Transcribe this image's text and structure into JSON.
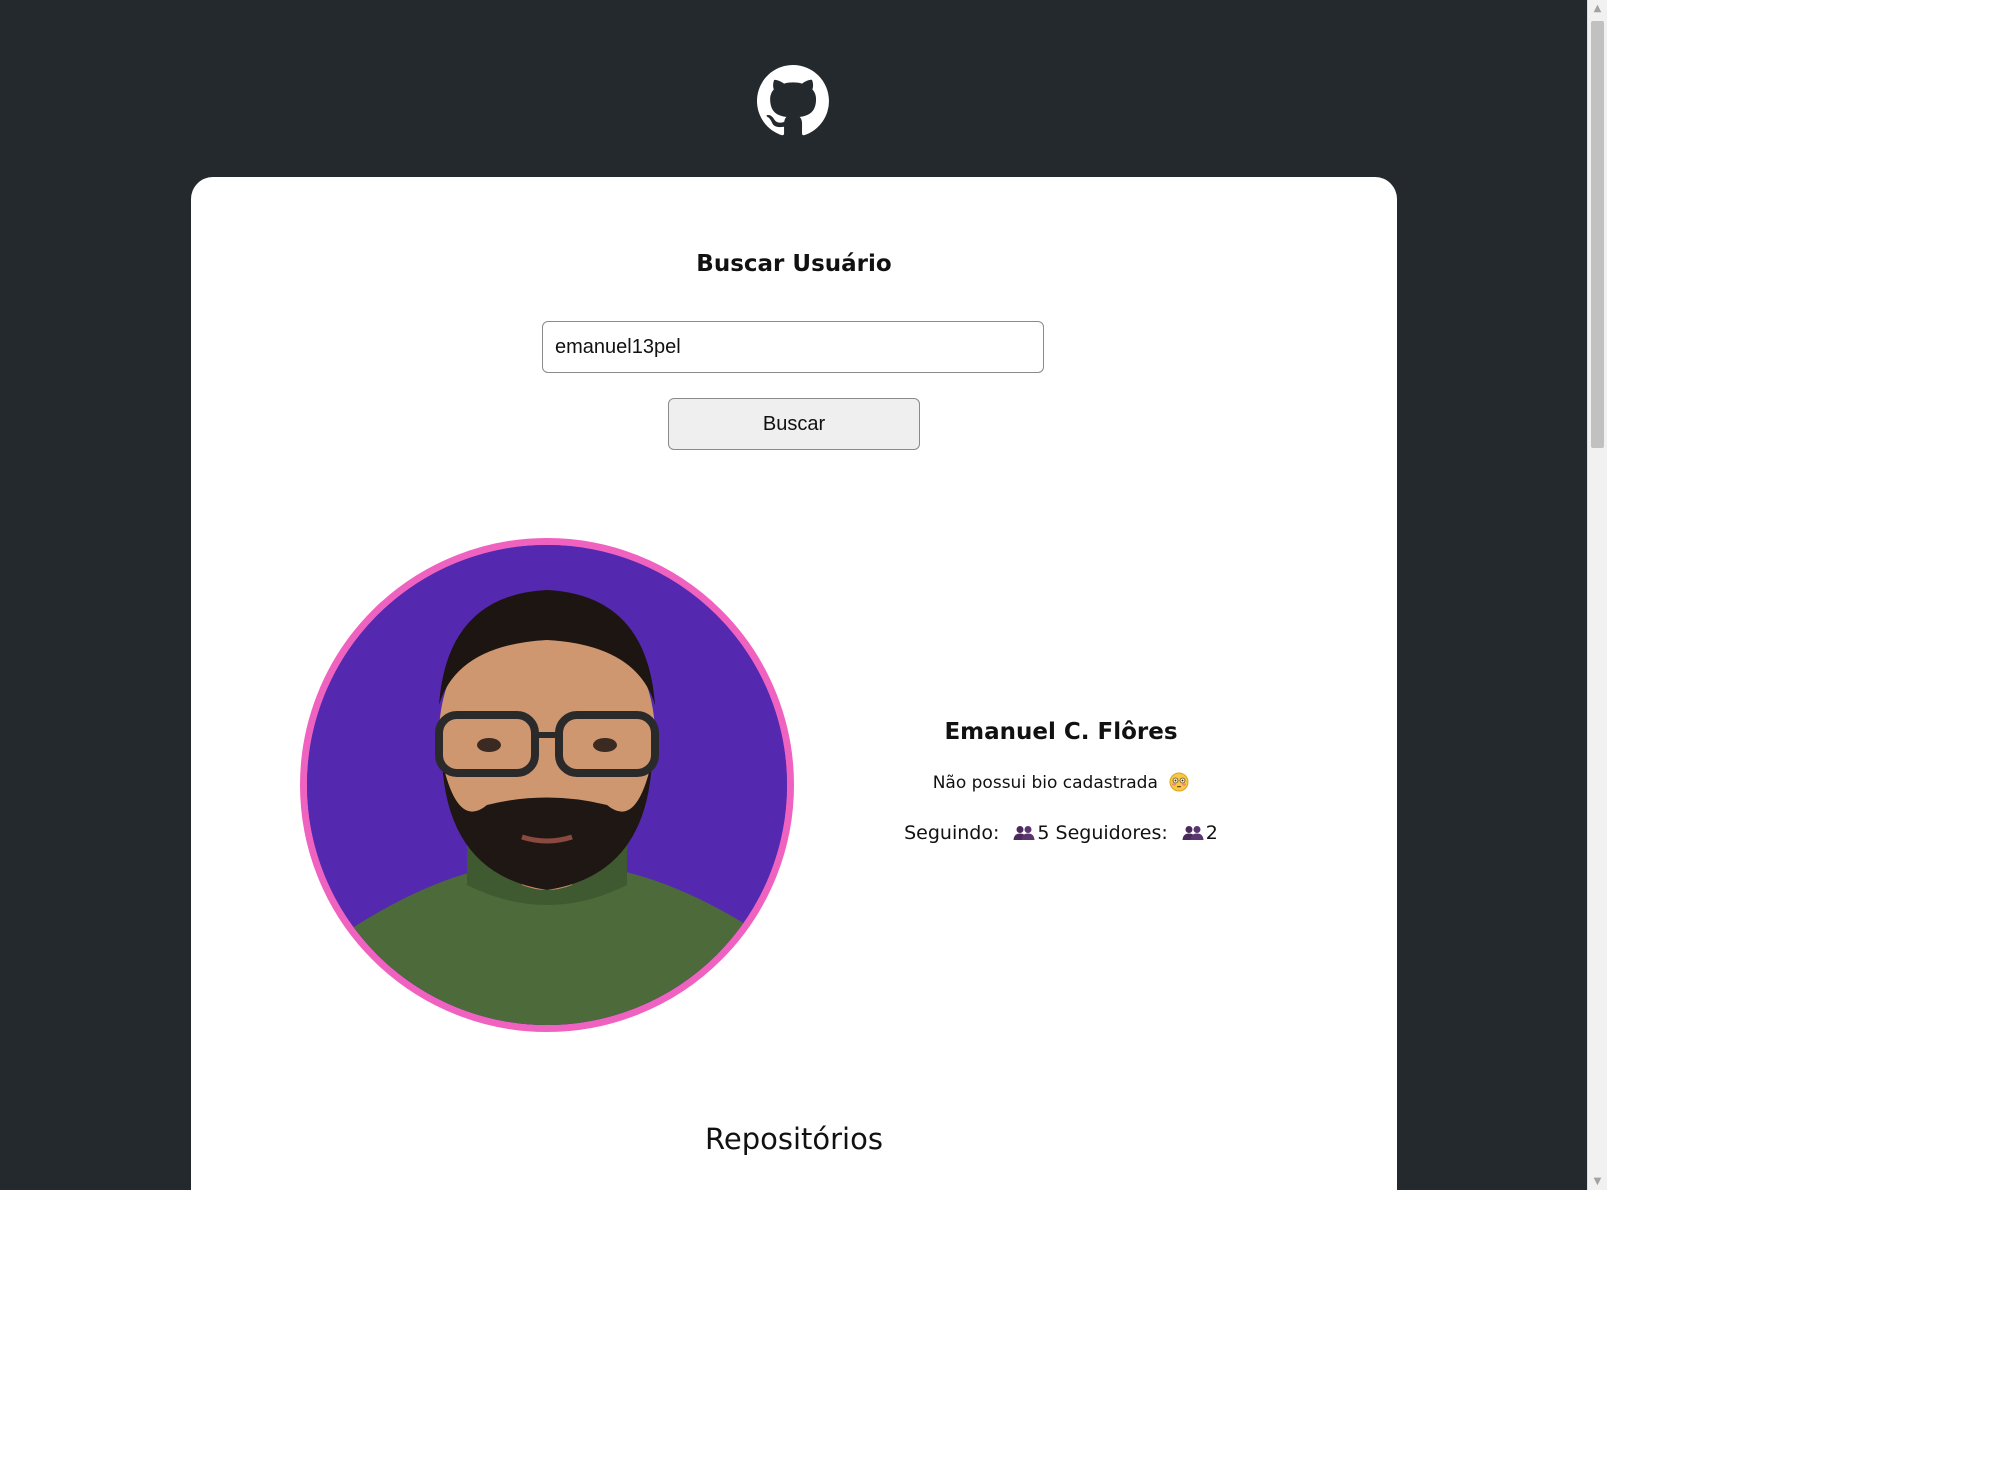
{
  "header": {
    "logo_icon": "github-octocat-icon"
  },
  "search": {
    "title": "Buscar Usuário",
    "input_value": "emanuel13pel",
    "button_label": "Buscar"
  },
  "profile": {
    "name": "Emanuel C. Flôres",
    "bio": "Não possui bio cadastrada",
    "bio_emoji_icon": "flushed-face-emoji",
    "following_label": "Seguindo:",
    "following_count": "5",
    "followers_label": "Seguidores:",
    "followers_count": "2",
    "people_icon": "people-icon",
    "avatar_border_color": "#f062c0",
    "avatar_bg_color": "#5429b0"
  },
  "repositories": {
    "title": "Repositórios"
  },
  "colors": {
    "page_background": "#24292e",
    "card_background": "#ffffff"
  }
}
